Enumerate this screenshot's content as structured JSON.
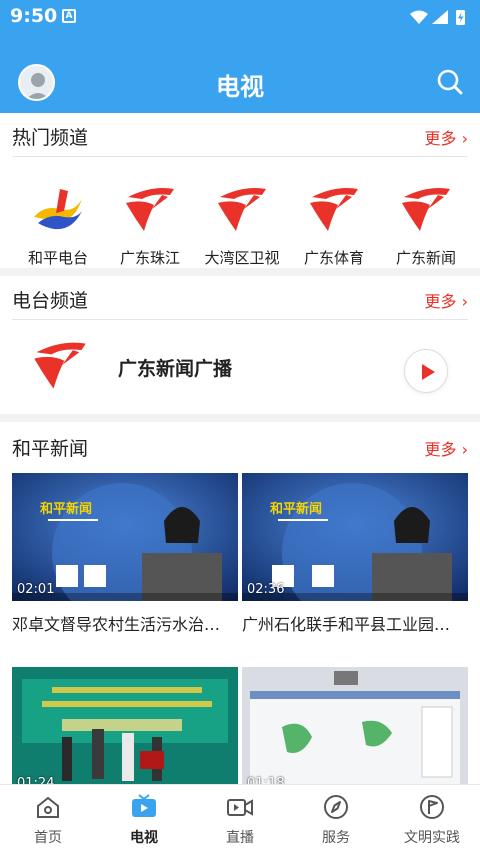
{
  "status": {
    "time": "9:50",
    "notif": "A"
  },
  "header": {
    "title": "电视"
  },
  "hot_channels": {
    "title": "热门频道",
    "more": "更多",
    "items": [
      {
        "name": "和平电台",
        "icon": "heping-logo-icon"
      },
      {
        "name": "广东珠江",
        "icon": "gdtv-logo-icon"
      },
      {
        "name": "大湾区卫视",
        "icon": "gdtv-logo-icon"
      },
      {
        "name": "广东体育",
        "icon": "gdtv-logo-icon"
      },
      {
        "name": "广东新闻",
        "icon": "gdtv-logo-icon"
      }
    ]
  },
  "radio": {
    "title": "电台频道",
    "more": "更多",
    "item": {
      "name": "广东新闻广播"
    }
  },
  "news": {
    "title": "和平新闻",
    "more": "更多",
    "videos": [
      {
        "title": "邓卓文督导农村生活污水治…",
        "duration": "02:01"
      },
      {
        "title": "广州石化联手和平县工业园…",
        "duration": "02:36"
      },
      {
        "title": "",
        "duration": "01:24"
      },
      {
        "title": "",
        "duration": "01:18"
      }
    ]
  },
  "tabbar": {
    "items": [
      {
        "label": "首页",
        "icon": "home-icon"
      },
      {
        "label": "电视",
        "icon": "tv-icon",
        "active": true
      },
      {
        "label": "直播",
        "icon": "live-video-icon"
      },
      {
        "label": "服务",
        "icon": "compass-icon"
      },
      {
        "label": "文明实践",
        "icon": "flag-icon"
      }
    ]
  },
  "colors": {
    "brand": "#3aa3f0",
    "accent": "#e8322a"
  }
}
